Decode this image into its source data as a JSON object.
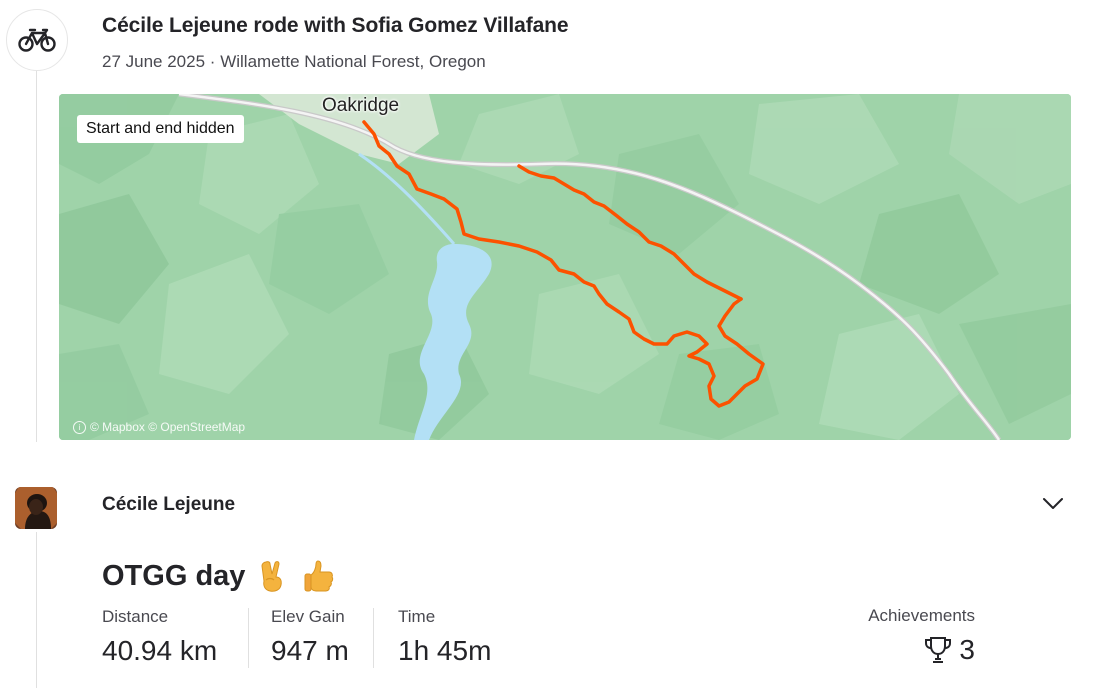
{
  "header": {
    "title": "Cécile Lejeune rode with Sofia Gomez Villafane",
    "date": "27 June 2025",
    "separator": "·",
    "location": "Willamette National Forest, Oregon",
    "sport_icon": "bike-icon"
  },
  "map": {
    "privacy_badge": "Start and end hidden",
    "town_label": "Oakridge",
    "attribution": "© Mapbox © OpenStreetMap",
    "route_color": "#fc5200",
    "water_color": "#b3e0f5",
    "terrain_color": "#9fd3a9"
  },
  "athlete": {
    "name": "Cécile Lejeune",
    "avatar_icon": "athlete-avatar",
    "expand_icon": "chevron-down-icon"
  },
  "activity": {
    "name": "OTGG day",
    "emojis": [
      "victory-hand-emoji",
      "thumbs-up-emoji"
    ]
  },
  "stats": {
    "distance_label": "Distance",
    "distance_value": "40.94 km",
    "elev_label": "Elev Gain",
    "elev_value": "947 m",
    "time_label": "Time",
    "time_value": "1h 45m",
    "achievements_label": "Achievements",
    "achievements_value": "3",
    "achievements_icon": "trophy-icon"
  }
}
